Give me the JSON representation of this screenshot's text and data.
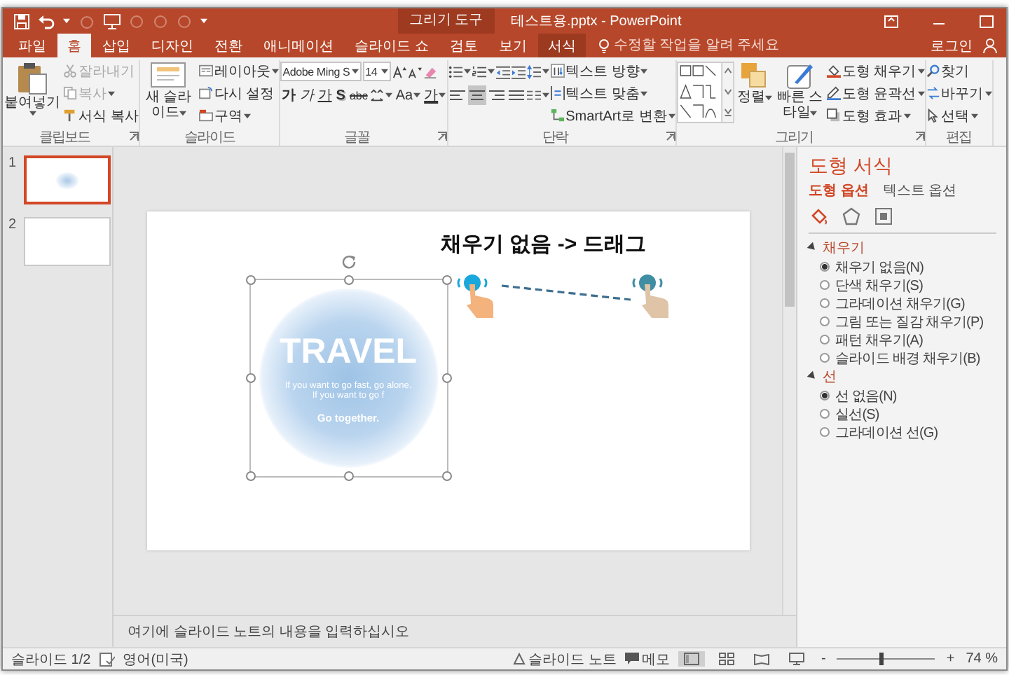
{
  "window": {
    "title": "테스트용.pptx - PowerPoint",
    "context_title": "그리기 도구"
  },
  "tabs": [
    {
      "label": "파일",
      "selected": false,
      "kind": "normal"
    },
    {
      "label": "홈",
      "selected": true,
      "kind": "normal"
    },
    {
      "label": "삽입",
      "selected": false,
      "kind": "normal"
    },
    {
      "label": "디자인",
      "selected": false,
      "kind": "normal"
    },
    {
      "label": "전환",
      "selected": false,
      "kind": "normal"
    },
    {
      "label": "애니메이션",
      "selected": false,
      "kind": "normal"
    },
    {
      "label": "슬라이드 쇼",
      "selected": false,
      "kind": "normal"
    },
    {
      "label": "검토",
      "selected": false,
      "kind": "normal"
    },
    {
      "label": "보기",
      "selected": false,
      "kind": "normal"
    },
    {
      "label": "서식",
      "selected": false,
      "kind": "contextual"
    }
  ],
  "tell_me": {
    "placeholder": "수정할 작업을 알려 주세요"
  },
  "account": {
    "label": "로그인"
  },
  "ribbon": [
    {
      "kind": "clipboard",
      "label": "클립보드",
      "launcher": true,
      "buttons": [
        {
          "label": "붙여넣기",
          "menu": true,
          "disabled": false
        },
        {
          "label": "잘라내기",
          "menu": false,
          "disabled": true
        },
        {
          "label": "복사",
          "menu": true,
          "disabled": true
        },
        {
          "label": "서식 복사",
          "menu": false,
          "disabled": false
        }
      ]
    },
    {
      "kind": "slides",
      "label": "슬라이드",
      "launcher": false,
      "buttons": [
        {
          "label": "새 슬라이드",
          "menu": true
        },
        {
          "label": "레이아웃",
          "menu": true
        },
        {
          "label": "다시 설정",
          "menu": false
        },
        {
          "label": "구역",
          "menu": true
        }
      ]
    },
    {
      "kind": "font",
      "label": "글꼴",
      "launcher": true,
      "font": {
        "value": "Adobe Ming S"
      },
      "size": {
        "value": "14"
      },
      "buttons": [
        {
          "label": "가",
          "kind": "bold"
        },
        {
          "label": "가",
          "kind": "italic"
        },
        {
          "label": "가",
          "kind": "underline"
        },
        {
          "label": "S",
          "kind": "shadow"
        },
        {
          "label": "abc",
          "kind": "strike"
        },
        {
          "label": "Aa",
          "kind": "case"
        },
        {
          "label": "가",
          "kind": "color"
        }
      ]
    },
    {
      "kind": "paragraph",
      "label": "단락",
      "launcher": true,
      "alignments": [
        {
          "selected": false
        },
        {
          "selected": true
        },
        {
          "selected": false
        },
        {
          "selected": false
        }
      ],
      "buttons": [
        {
          "label": "텍스트 방향",
          "menu": true
        },
        {
          "label": "텍스트 맞춤",
          "menu": true
        },
        {
          "label": "SmartArt로 변환",
          "menu": true
        }
      ]
    },
    {
      "kind": "drawing",
      "label": "그리기",
      "launcher": true,
      "buttons": [
        {
          "label": "정렬",
          "menu": true
        },
        {
          "label": "빠른 스타일",
          "menu": true
        },
        {
          "label": "도형 채우기",
          "menu": true
        },
        {
          "label": "도형 윤곽선",
          "menu": true
        },
        {
          "label": "도형 효과",
          "menu": true
        }
      ]
    },
    {
      "kind": "editing",
      "label": "편집",
      "launcher": false,
      "buttons": [
        {
          "label": "찾기",
          "menu": false
        },
        {
          "label": "바꾸기",
          "menu": true
        },
        {
          "label": "선택",
          "menu": true
        }
      ]
    }
  ],
  "thumbnails": [
    {
      "number": "1",
      "selected": true
    },
    {
      "number": "2",
      "selected": false
    }
  ],
  "slide": {
    "caption": "채우기 없음 -> 드래그",
    "shape": {
      "selected": true,
      "title": "TRAVEL",
      "lines": [
        "If you want to go fast, go alone.",
        "If you want to go f"
      ],
      "tagline": "Go together."
    }
  },
  "notes": {
    "placeholder": "여기에 슬라이드 노트의 내용을 입력하십시오"
  },
  "format_pane": {
    "title": "도형 서식",
    "tabs": [
      {
        "label": "도형 옵션",
        "selected": true
      },
      {
        "label": "텍스트 옵션",
        "selected": false
      }
    ],
    "icon_tabs": [
      {
        "selected": true
      },
      {
        "selected": false
      },
      {
        "selected": false
      }
    ],
    "sections": [
      {
        "label": "채우기",
        "expanded": true,
        "options": [
          {
            "label": "채우기 없음(N)",
            "selected": true
          },
          {
            "label": "단색 채우기(S)",
            "selected": false
          },
          {
            "label": "그라데이션 채우기(G)",
            "selected": false
          },
          {
            "label": "그림 또는 질감 채우기(P)",
            "selected": false
          },
          {
            "label": "패턴 채우기(A)",
            "selected": false
          },
          {
            "label": "슬라이드 배경 채우기(B)",
            "selected": false
          }
        ]
      },
      {
        "label": "선",
        "expanded": true,
        "options": [
          {
            "label": "선 없음(N)",
            "selected": true
          },
          {
            "label": "실선(S)",
            "selected": false
          },
          {
            "label": "그라데이션 선(G)",
            "selected": false
          }
        ]
      }
    ]
  },
  "status_bar": {
    "slide": "슬라이드 1/2",
    "language": "영어(미국)",
    "notes": "슬라이드 노트",
    "comments": "메모",
    "views": [
      {
        "kind": "normal",
        "selected": true
      },
      {
        "kind": "sorter",
        "selected": false
      },
      {
        "kind": "reading",
        "selected": false
      },
      {
        "kind": "show",
        "selected": false
      }
    ],
    "zoom_out": "-",
    "zoom_in": "+",
    "zoom": {
      "level": 0.45,
      "reading": "74 %"
    }
  }
}
